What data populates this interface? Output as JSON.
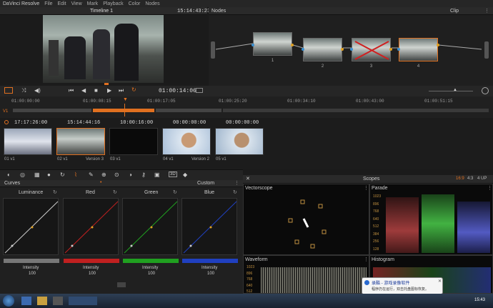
{
  "menu": {
    "app": "DaVinci Resolve",
    "items": [
      "File",
      "Edit",
      "View",
      "Mark",
      "Playback",
      "Color",
      "Nodes"
    ]
  },
  "viewer": {
    "timeline_label": "Timeline 1",
    "timecode": "15:14:43:23",
    "playhead_tc": "01:00:14:06"
  },
  "nodes": {
    "title": "Nodes",
    "mode": "Clip",
    "items": [
      {
        "num": "1"
      },
      {
        "num": "2"
      },
      {
        "num": "3"
      },
      {
        "num": "4"
      }
    ]
  },
  "ruler": [
    "01:00:00:00",
    "01:00:08:15",
    "01:00:17:05",
    "01:00:25:20",
    "01:00:34:10",
    "01:00:43:00",
    "01:00:51:15"
  ],
  "track_label": "V1",
  "clips": [
    {
      "tc": "17:17:26:00",
      "name": "01  v1",
      "version": ""
    },
    {
      "tc": "15:14:44:16",
      "name": "02  v1",
      "version": "Version 3"
    },
    {
      "tc": "10:00:16:00",
      "name": "03  v1",
      "version": ""
    },
    {
      "tc": "00:00:00:00",
      "name": "04  v1",
      "version": "Version 2"
    },
    {
      "tc": "00:00:00:00",
      "name": "05  v1",
      "version": ""
    }
  ],
  "curves": {
    "title": "Curves",
    "preset": "Custom",
    "channels": [
      {
        "name": "Luminance",
        "intensity_label": "Intensity",
        "intensity": "100",
        "color": "#888888"
      },
      {
        "name": "Red",
        "intensity_label": "Intensity",
        "intensity": "100",
        "color": "#c02020"
      },
      {
        "name": "Green",
        "intensity_label": "Intensity",
        "intensity": "100",
        "color": "#20a020"
      },
      {
        "name": "Blue",
        "intensity_label": "Intensity",
        "intensity": "100",
        "color": "#2040c0"
      }
    ]
  },
  "scopes": {
    "title": "Scopes",
    "res": "16:9",
    "zoom": "4:3",
    "up": "4 UP",
    "vectorscope": "Vectorscope",
    "parade": "Parade",
    "waveform": "Waveform",
    "histogram": "Histogram",
    "parade_ticks": [
      "1023",
      "896",
      "768",
      "640",
      "512",
      "384",
      "256",
      "128"
    ],
    "waveform_ticks": [
      "1023",
      "896",
      "768",
      "640",
      "512"
    ]
  },
  "notification": {
    "title": "录酷 - 游戏录像软件",
    "body": "程序仍在运行，双击托盘图标恢复。"
  },
  "taskbar": {
    "clock": "15:43"
  }
}
